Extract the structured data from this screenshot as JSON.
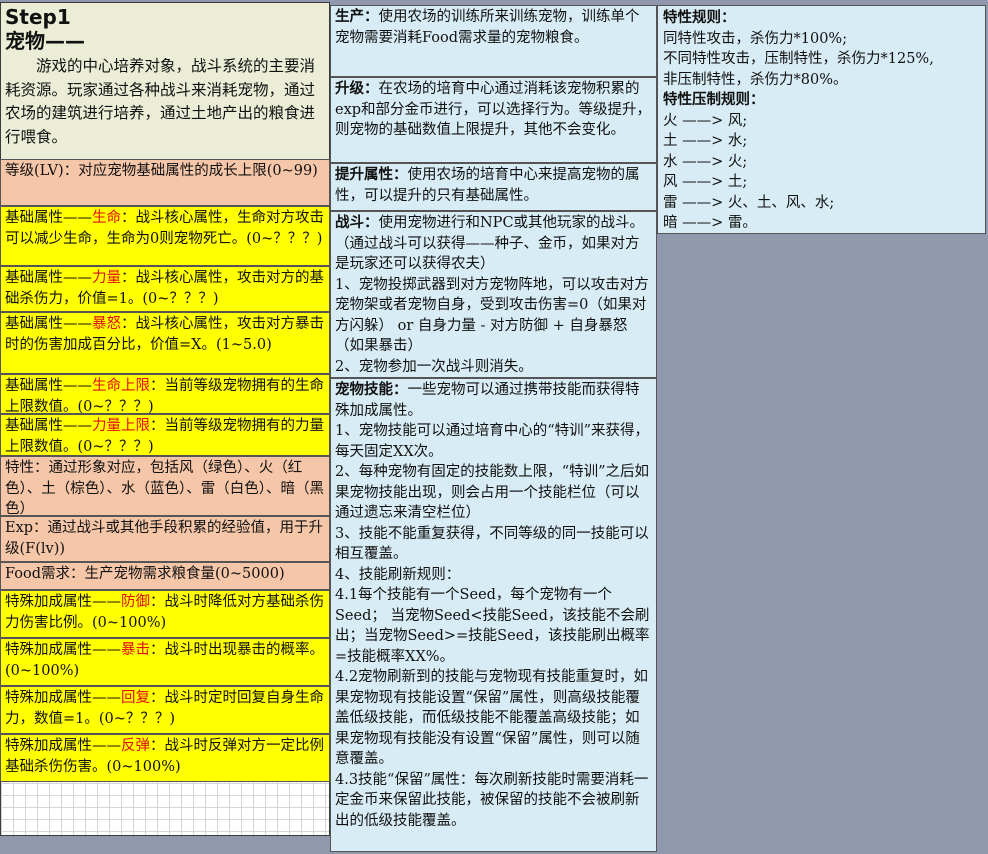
{
  "left": {
    "step": "Step1",
    "title": "宠物——",
    "intro": "游戏的中心培养对象，战斗系统的主要消耗资源。玩家通过各种战斗来消耗宠物，通过农场的建筑进行培养，通过土地产出的粮食进行喂食。",
    "rows": [
      {
        "pre": "等级(LV)：对应宠物基础属性的成长上限(0~99)",
        "hl": "",
        "post": ""
      },
      {
        "pre": "基础属性——",
        "hl": "生命",
        "post": "：战斗核心属性，生命对方攻击可以减少生命，生命为0则宠物死亡。(0~？？？)"
      },
      {
        "pre": "基础属性——",
        "hl": "力量",
        "post": "：战斗核心属性，攻击对方的基础杀伤力，价值=1。(0~？？？)"
      },
      {
        "pre": "基础属性——",
        "hl": "暴怒",
        "post": "：战斗核心属性，攻击对方暴击时的伤害加成百分比，价值=X。(1~5.0)"
      },
      {
        "pre": "基础属性——",
        "hl": "生命上限",
        "post": "：当前等级宠物拥有的生命上限数值。(0~？？？)"
      },
      {
        "pre": "基础属性——",
        "hl": "力量上限",
        "post": "：当前等级宠物拥有的力量上限数值。(0~？？？)"
      },
      {
        "pre": "特性：通过形象对应，包括风（绿色）、火（红色）、土（棕色）、水（蓝色）、雷（白色）、暗（黑色）",
        "hl": "",
        "post": ""
      },
      {
        "pre": "Exp：通过战斗或其他手段积累的经验值，用于升级(F(lv))",
        "hl": "",
        "post": ""
      },
      {
        "pre": "Food需求：生产宠物需求粮食量(0~5000)",
        "hl": "",
        "post": ""
      },
      {
        "pre": "特殊加成属性——",
        "hl": "防御",
        "post": "：战斗时降低对方基础杀伤力伤害比例。(0~100%)"
      },
      {
        "pre": "特殊加成属性——",
        "hl": "暴击",
        "post": "：战斗时出现暴击的概率。(0~100%)"
      },
      {
        "pre": "特殊加成属性——",
        "hl": "回复",
        "post": "：战斗时定时回复自身生命力，数值=1。(0~？？？)"
      },
      {
        "pre": "特殊加成属性——",
        "hl": "反弹",
        "post": "：战斗时反弹对方一定比例基础杀伤伤害。(0~100%)"
      }
    ]
  },
  "mid": {
    "produce": {
      "head": "生产：",
      "text": "使用农场的训练所来训练宠物，训练单个宠物需要消耗Food需求量的宠物粮食。"
    },
    "upgrade": {
      "head": "升级：",
      "text": "在农场的培育中心通过消耗该宠物积累的exp和部分金币进行，可以选择行为。等级提升，则宠物的基础数值上限提升，其他不会变化。"
    },
    "boost": {
      "head": "提升属性：",
      "text": "使用农场的培育中心来提高宠物的属性，可以提升的只有基础属性。"
    },
    "battle": {
      "head": "战斗：",
      "text": "使用宠物进行和NPC或其他玩家的战斗。（通过战斗可以获得——种子、金币，如果对方是玩家还可以获得农夫）",
      "p1": "1、宠物投掷武器到对方宠物阵地，可以攻击对方宠物架或者宠物自身，受到攻击伤害=0（如果对方闪躲） or 自身力量 - 对方防御 + 自身暴怒（如果暴击）",
      "p2": "2、宠物参加一次战斗则消失。"
    },
    "skill": {
      "head": "宠物技能：",
      "text": "一些宠物可以通过携带技能而获得特殊加成属性。",
      "items": [
        "1、宠物技能可以通过培育中心的“特训”来获得，每天固定XX次。",
        "2、每种宠物有固定的技能数上限，“特训”之后如果宠物技能出现，则会占用一个技能栏位（可以通过遗忘来清空栏位）",
        "3、技能不能重复获得，不同等级的同一技能可以相互覆盖。",
        "4、技能刷新规则：",
        "4.1每个技能有一个Seed，每个宠物有一个Seed； 当宠物Seed<技能Seed，该技能不会刷出；当宠物Seed>=技能Seed，该技能刷出概率=技能概率XX%。",
        "4.2宠物刷新到的技能与宠物现有技能重复时，如果宠物现有技能设置“保留”属性，则高级技能覆盖低级技能，而低级技能不能覆盖高级技能；如果宠物现有技能没有设置“保留”属性，则可以随意覆盖。",
        "4.3技能“保留”属性：每次刷新技能时需要消耗一定金币来保留此技能，被保留的技能不会被刷新出的低级技能覆盖。"
      ]
    }
  },
  "right": {
    "rules_title": "特性规则：",
    "rules": [
      "同特性攻击，杀伤力*100%;",
      "不同特性攻击，压制特性，杀伤力*125%,",
      "非压制特性，杀伤力*80%。"
    ],
    "suppress_title": "特性压制规则：",
    "suppress": [
      "火 ——> 风;",
      "土 ——> 水;",
      "水 ——> 火;",
      "风 ——> 土;",
      "雷 ——> 火、土、风、水;",
      "暗 ——> 雷。"
    ]
  }
}
